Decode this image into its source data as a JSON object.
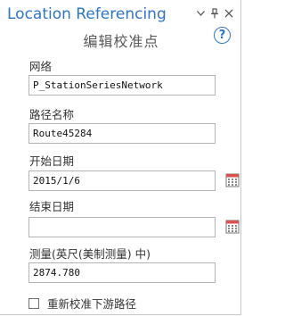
{
  "pane": {
    "title": "Location Referencing",
    "subtitle": "编辑校准点",
    "help_glyph": "?"
  },
  "fields": {
    "network": {
      "label": "网络",
      "value": "P_StationSeriesNetwork"
    },
    "route_name": {
      "label": "路径名称",
      "value": "Route45284"
    },
    "start_date": {
      "label": "开始日期",
      "value": "2015/1/6"
    },
    "end_date": {
      "label": "结束日期",
      "value": ""
    },
    "measure": {
      "label": "测量(英尺(美制测量) 中)",
      "value": "2874.780"
    }
  },
  "options": {
    "recalibrate_downstream": {
      "label": "重新校准下游路径",
      "checked": false
    }
  },
  "colors": {
    "accent": "#2e75c4",
    "calendar_red": "#d9534f"
  },
  "icons": [
    "chevron-down-icon",
    "pin-icon",
    "close-icon",
    "help-icon",
    "calendar-icon"
  ]
}
